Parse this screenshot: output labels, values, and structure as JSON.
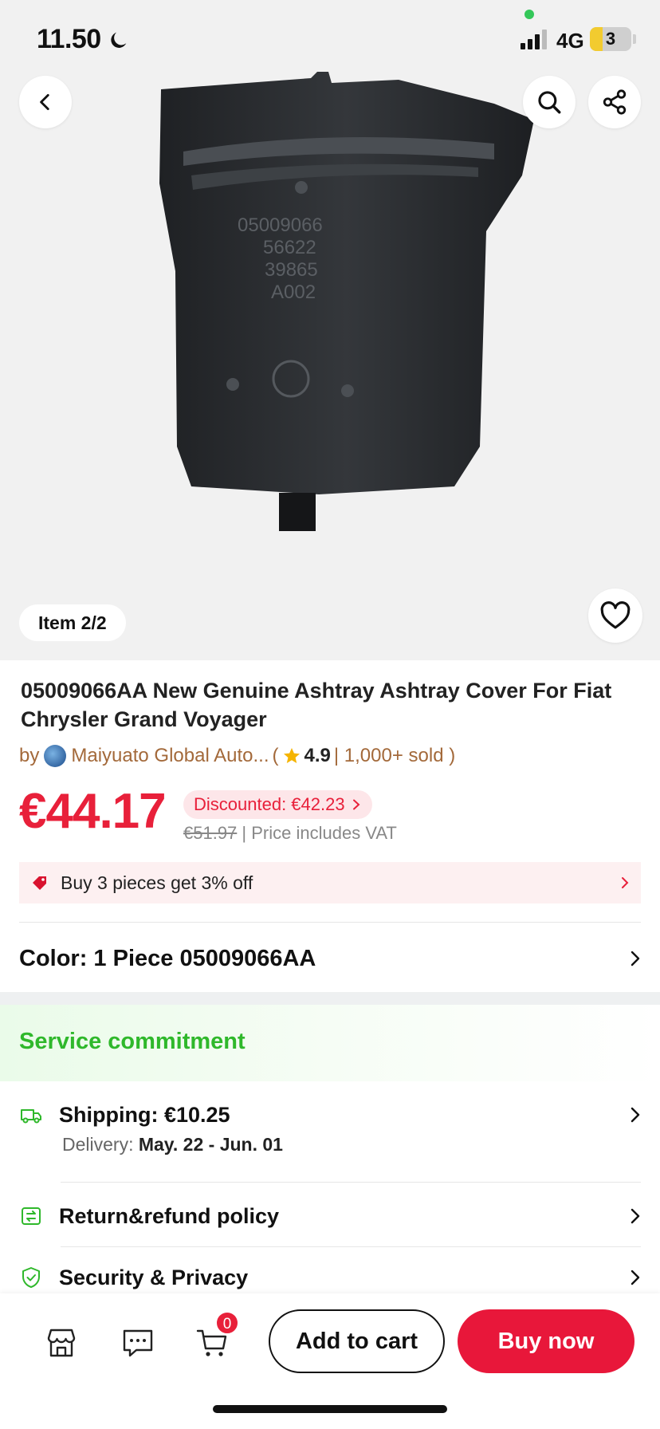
{
  "status": {
    "time": "11.50",
    "network": "4G",
    "battery": "3",
    "battery_level": 0.3
  },
  "gallery": {
    "item_indicator": "Item 2/2"
  },
  "product": {
    "title": "05009066AA New Genuine Ashtray Ashtray Cover For Fiat Chrysler Grand Voyager",
    "by": "by",
    "seller": "Maiyuato Global Auto...",
    "open_paren": "(",
    "rating": "4.9",
    "sold": "| 1,000+ sold )",
    "price": "€44.17",
    "discount": "Discounted: €42.23",
    "original_price": "€51.97",
    "vat_note": "| Price includes VAT",
    "promo": "Buy 3 pieces get 3% off",
    "color_option": "Color: 1 Piece 05009066AA"
  },
  "service": {
    "title": "Service commitment",
    "shipping": "Shipping: €10.25",
    "delivery_label": "Delivery:",
    "delivery_dates": "May. 22 - Jun. 01",
    "return_policy": "Return&refund policy",
    "security": "Security & Privacy"
  },
  "bottom": {
    "cart_count": "0",
    "add_to_cart": "Add to cart",
    "buy_now": "Buy now"
  },
  "colors": {
    "accent": "#e8203a",
    "service_green": "#2fb82b",
    "seller_brown": "#a3693a"
  }
}
